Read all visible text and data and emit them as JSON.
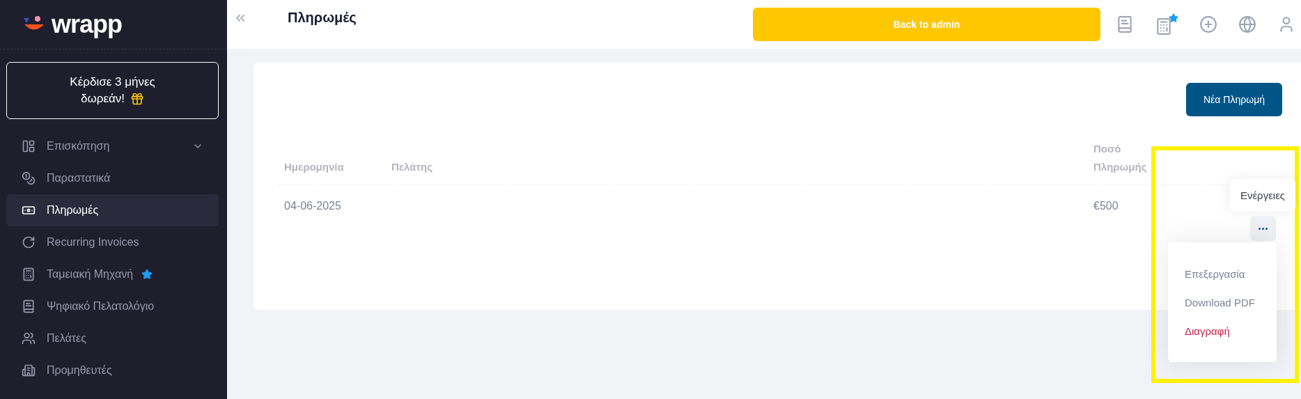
{
  "sidebar": {
    "logo": "wrapp",
    "promo": {
      "line1": "Κέρδισε 3 μήνες",
      "line2": "δωρεάν!"
    },
    "items": [
      {
        "label": "Επισκόπηση",
        "selected": false,
        "expandable": true,
        "starred": false
      },
      {
        "label": "Παραστατικά",
        "selected": false,
        "expandable": false,
        "starred": false
      },
      {
        "label": "Πληρωμές",
        "selected": true,
        "expandable": false,
        "starred": false
      },
      {
        "label": "Recurring Invoices",
        "selected": false,
        "expandable": false,
        "starred": false
      },
      {
        "label": "Ταμειακή Μηχανή",
        "selected": false,
        "expandable": false,
        "starred": true
      },
      {
        "label": "Ψηφιακό Πελατολόγιο",
        "selected": false,
        "expandable": false,
        "starred": false
      },
      {
        "label": "Πελάτες",
        "selected": false,
        "expandable": false,
        "starred": false
      },
      {
        "label": "Προμηθευτές",
        "selected": false,
        "expandable": false,
        "starred": false
      }
    ]
  },
  "header": {
    "title": "Πληρωμές",
    "admin_button": "Back to admin"
  },
  "toolbar": {
    "new_button": "Νέα Πληρωμή"
  },
  "table": {
    "columns": [
      "Ημερομηνία",
      "Πελάτης",
      "Ποσό Πληρωμής"
    ],
    "rows": [
      {
        "date": "04-06-2025",
        "amount": "€500"
      }
    ]
  },
  "tooltip": "Ενέργειες",
  "menu": [
    {
      "label": "Επεξεργασία",
      "kind": "normal"
    },
    {
      "label": "Download PDF",
      "kind": "normal"
    },
    {
      "label": "Διαγραφή",
      "kind": "danger"
    }
  ]
}
